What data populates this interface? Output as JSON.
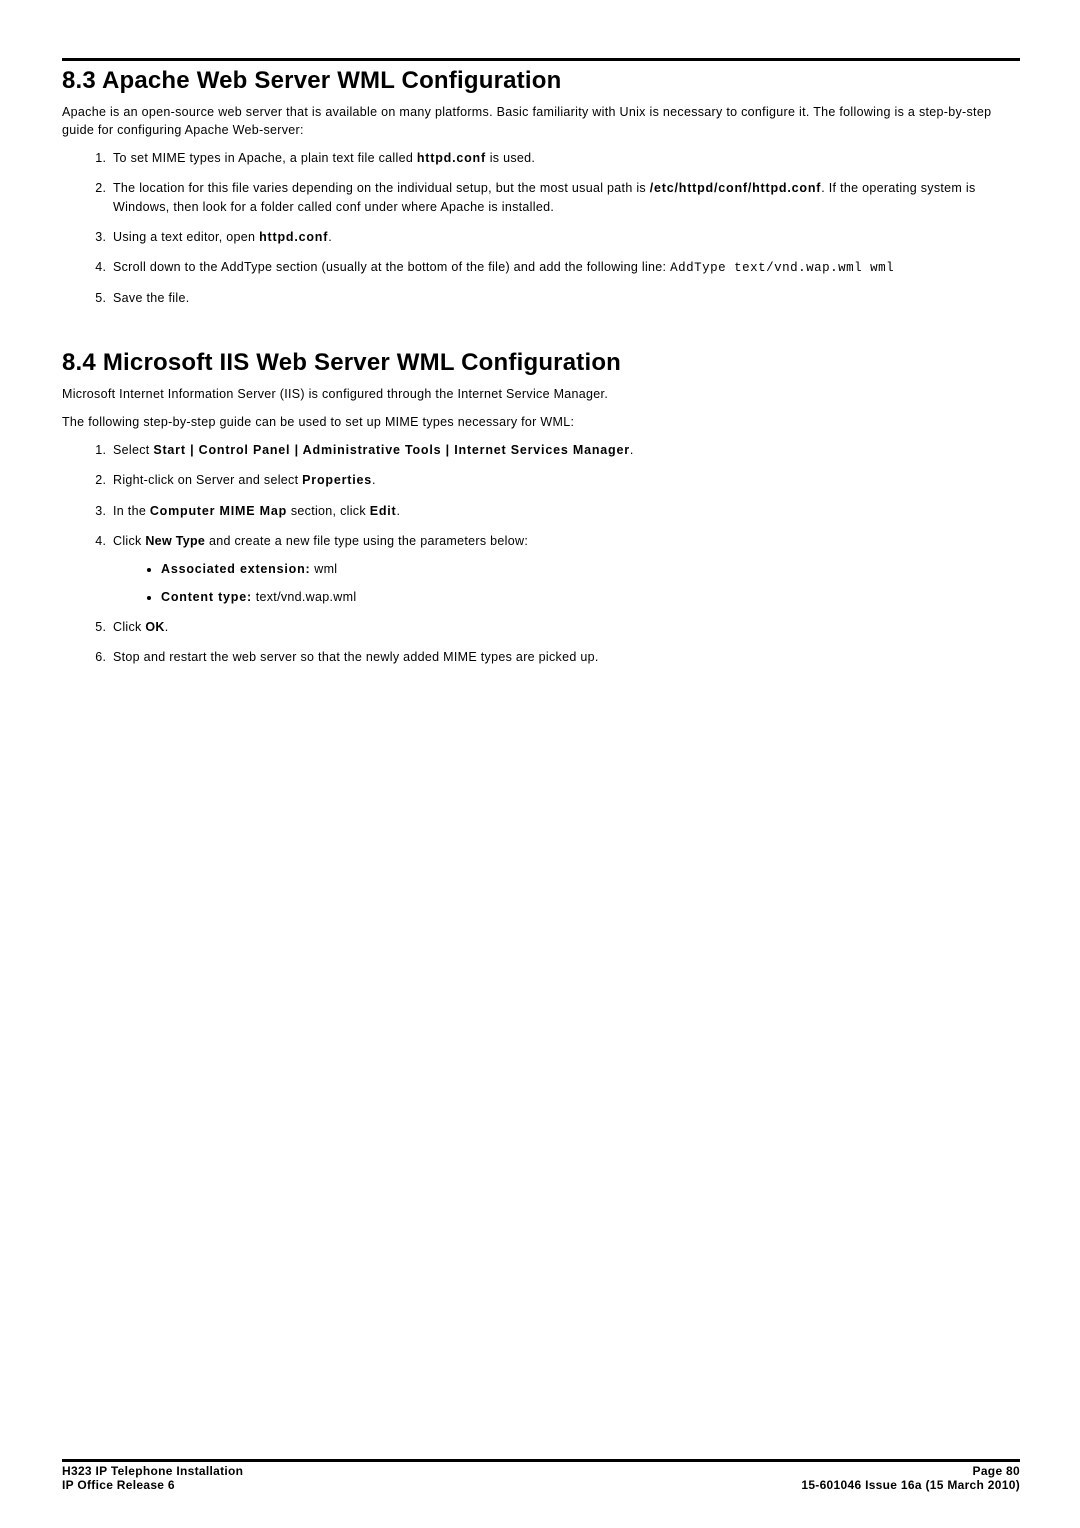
{
  "section83": {
    "title": "8.3 Apache Web Server WML Configuration",
    "intro": "Apache is an open-source web server that is available on many platforms. Basic familiarity with Unix is necessary to configure it. The following is a step-by-step guide for configuring Apache Web-server:",
    "items": {
      "i1a": "To set MIME types in Apache, a plain text file called ",
      "i1b": "httpd.conf",
      "i1c": " is used.",
      "i2a": "The location for this file varies depending on the individual setup, but the most usual path is ",
      "i2b": "/etc/httpd/conf/httpd.conf",
      "i2c": ". If the operating system is Windows, then look for a folder called conf under where Apache is installed.",
      "i3a": "Using a text editor, open ",
      "i3b": "httpd.conf",
      "i3c": ".",
      "i4a": "Scroll down to the AddType section (usually at the bottom of the file) and add the following line: ",
      "i4code": "AddType text/vnd.wap.wml wml",
      "i5": "Save the file."
    }
  },
  "section84": {
    "title": "8.4 Microsoft IIS Web Server WML Configuration",
    "intro1": "Microsoft Internet Information Server (IIS) is configured through the Internet Service Manager.",
    "intro2": "The following step-by-step guide can be used to set up MIME types necessary for WML:",
    "items": {
      "i1a": "Select ",
      "i1b": "Start | Control Panel | Administrative Tools | Internet Services Manager",
      "i1c": ".",
      "i2a": "Right-click on Server and select ",
      "i2b": "Properties",
      "i2c": ".",
      "i3a": "In the ",
      "i3b": "Computer MIME Map",
      "i3c": " section, click ",
      "i3d": "Edit",
      "i3e": ".",
      "i4a": "Click ",
      "i4b": "New Type",
      "i4c": " and create a new file type using the parameters below:",
      "b1a": "Associated extension:",
      "b1b": " wml",
      "b2a": "Content type:",
      "b2b": " text/vnd.wap.wml",
      "i5a": "Click ",
      "i5b": "OK",
      "i5c": ".",
      "i6": "Stop and restart the web server so that the newly added MIME types are picked up."
    }
  },
  "footer": {
    "left1": "H323 IP Telephone Installation",
    "left2": "IP Office Release 6",
    "right1": "Page 80",
    "right2": "15-601046 Issue 16a (15 March 2010)"
  }
}
